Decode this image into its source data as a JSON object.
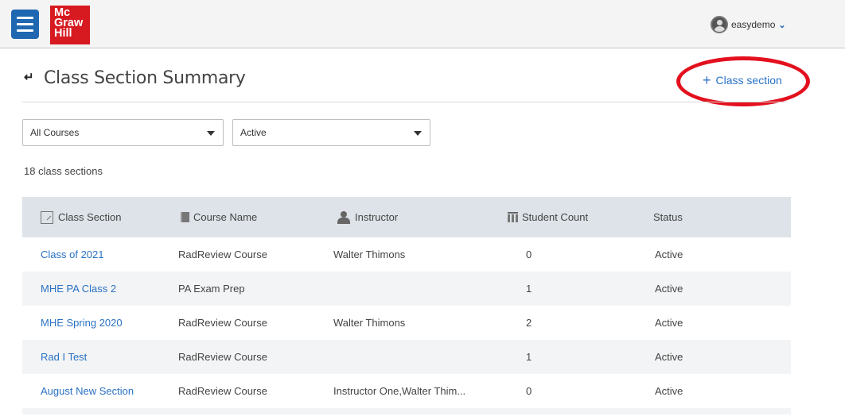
{
  "header": {
    "logo_lines": [
      "Mc",
      "Graw",
      "Hill"
    ],
    "username": "easydemo"
  },
  "page": {
    "title": "Class Section Summary",
    "add_label": "Class section"
  },
  "filters": {
    "course": "All Courses",
    "status": "Active"
  },
  "summary": {
    "count_text": "18 class sections"
  },
  "table": {
    "columns": [
      "Class Section",
      "Course Name",
      "Instructor",
      "Student Count",
      "Status"
    ],
    "rows": [
      {
        "section": "Class of 2021",
        "course": "RadReview Course",
        "instructor": "Walter Thimons",
        "count": "0",
        "status": "Active"
      },
      {
        "section": "MHE PA Class 2",
        "course": "PA Exam Prep",
        "instructor": "",
        "count": "1",
        "status": "Active"
      },
      {
        "section": "MHE Spring 2020",
        "course": "RadReview Course",
        "instructor": "Walter Thimons",
        "count": "2",
        "status": "Active"
      },
      {
        "section": "Rad I Test",
        "course": "RadReview Course",
        "instructor": "",
        "count": "1",
        "status": "Active"
      },
      {
        "section": "August New Section",
        "course": "RadReview Course",
        "instructor": "Instructor One,Walter Thim...",
        "count": "0",
        "status": "Active"
      }
    ]
  },
  "colors": {
    "brand_blue": "#1f67b1",
    "logo_red": "#d71920",
    "link_blue": "#2a72c4",
    "highlight_red": "#e3101e"
  }
}
